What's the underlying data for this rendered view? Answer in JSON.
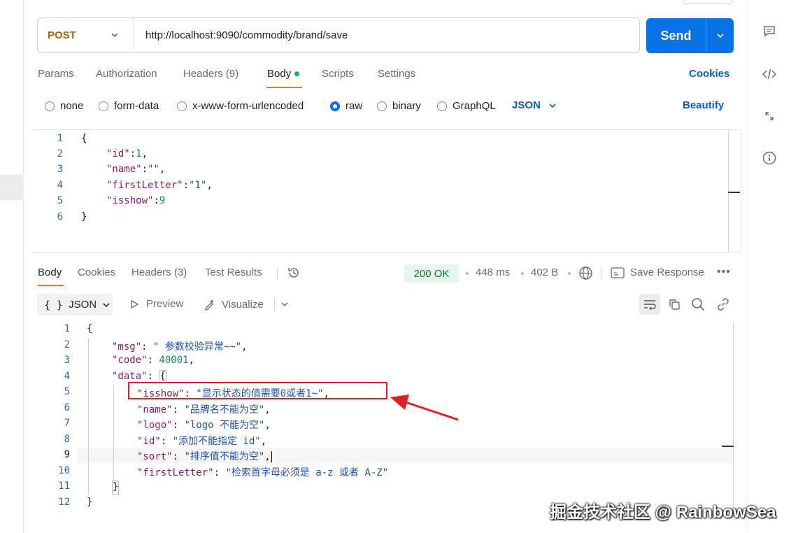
{
  "request": {
    "method": "POST",
    "url": "http://localhost:9090/commodity/brand/save",
    "send_label": "Send",
    "tabs": [
      "Params",
      "Authorization",
      "Headers (9)",
      "Body",
      "Scripts",
      "Settings"
    ],
    "cookies_label": "Cookies",
    "body_types": [
      "none",
      "form-data",
      "x-www-form-urlencoded",
      "raw",
      "binary",
      "GraphQL"
    ],
    "selected_body_type": "raw",
    "format": "JSON",
    "beautify_label": "Beautify",
    "body_lines": [
      {
        "n": "1",
        "text": "{"
      },
      {
        "n": "2",
        "key": "\"id\"",
        "sep": ":",
        "val": "1",
        "end": ","
      },
      {
        "n": "3",
        "key": "\"name\"",
        "sep": ":",
        "val": "\"\"",
        "end": ","
      },
      {
        "n": "4",
        "key": "\"firstLetter\"",
        "sep": ":",
        "val": "\"1\"",
        "end": ","
      },
      {
        "n": "5",
        "key": "\"isshow\"",
        "sep": ":",
        "val": "9",
        "end": ""
      },
      {
        "n": "6",
        "text": "}"
      }
    ]
  },
  "response": {
    "tabs": [
      "Body",
      "Cookies",
      "Headers (3)",
      "Test Results"
    ],
    "status": "200 OK",
    "time": "448 ms",
    "size": "402 B",
    "save_label": "Save Response",
    "format": "JSON",
    "preview_label": "Preview",
    "visualize_label": "Visualize",
    "body_lines": [
      {
        "n": "1",
        "text": "{"
      },
      {
        "n": "2",
        "key": "\"msg\"",
        "val": "\" 参数校验异常~~\"",
        "end": ","
      },
      {
        "n": "3",
        "key": "\"code\"",
        "val": "40001",
        "end": ","
      },
      {
        "n": "4",
        "key": "\"data\"",
        "val": "{",
        "end": ""
      },
      {
        "n": "5",
        "key": "\"isshow\"",
        "val": "\"显示状态的值需要0或者1~\"",
        "end": ","
      },
      {
        "n": "6",
        "key": "\"name\"",
        "val": "\"品牌名不能为空\"",
        "end": ","
      },
      {
        "n": "7",
        "key": "\"logo\"",
        "val": "\"logo 不能为空\"",
        "end": ","
      },
      {
        "n": "8",
        "key": "\"id\"",
        "val": "\"添加不能指定 id\"",
        "end": ","
      },
      {
        "n": "9",
        "key": "\"sort\"",
        "val": "\"排序值不能为空\"",
        "end": ","
      },
      {
        "n": "10",
        "key": "\"firstLetter\"",
        "val": "\"检索首字母必须是 a-z 或者 A-Z\"",
        "end": ""
      },
      {
        "n": "11",
        "text": "}"
      },
      {
        "n": "12",
        "text": "}"
      }
    ]
  },
  "watermark": "掘金技术社区 @ RainbowSea"
}
